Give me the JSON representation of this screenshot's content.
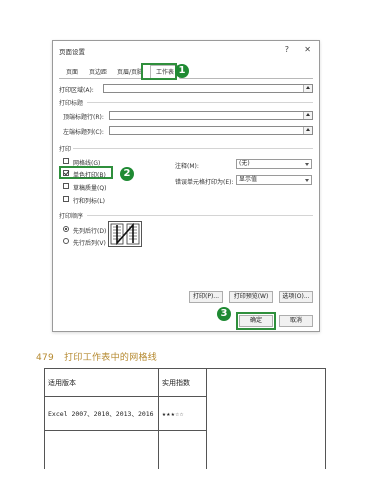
{
  "dialog": {
    "title": "页面设置",
    "help_glyph": "?",
    "close_glyph": "✕",
    "tabs": [
      {
        "label": "页面"
      },
      {
        "label": "页边距"
      },
      {
        "label": "页眉/页脚"
      },
      {
        "label": "工作表",
        "selected": true
      }
    ],
    "print_area_label": "打印区域(A):",
    "print_titles_section": "打印标题",
    "top_rows_label": "顶端标题行(R):",
    "left_cols_label": "左端标题列(C):",
    "print_section": "打印",
    "checkboxes": [
      {
        "label": "网格线(G)",
        "checked": false
      },
      {
        "label": "单色打印(B)",
        "checked": true
      },
      {
        "label": "草稿质量(Q)",
        "checked": false
      },
      {
        "label": "行和列标(L)",
        "checked": false
      }
    ],
    "comments_label": "注释(M):",
    "comments_value": "(无)",
    "errors_label": "错误单元格打印为(E):",
    "errors_value": "显示值",
    "page_order_section": "打印顺序",
    "radios": [
      {
        "label": "先列后行(D)",
        "checked": true
      },
      {
        "label": "先行后列(V)",
        "checked": false
      }
    ],
    "buttons": {
      "print": "打印(P)...",
      "preview": "打印预览(W)",
      "options": "选项(O)...",
      "ok": "确定",
      "cancel": "取消"
    }
  },
  "badges": [
    "1",
    "2",
    "3"
  ],
  "accent_color": "#2f8f3c",
  "caption": {
    "number": "479",
    "text": "打印工作表中的网格线",
    "color": "#b5892f"
  },
  "info_table": {
    "headers": [
      "适用版本",
      "实用指数"
    ],
    "row": [
      "Excel 2007、2010、2013、2016",
      "★★★☆☆"
    ]
  }
}
